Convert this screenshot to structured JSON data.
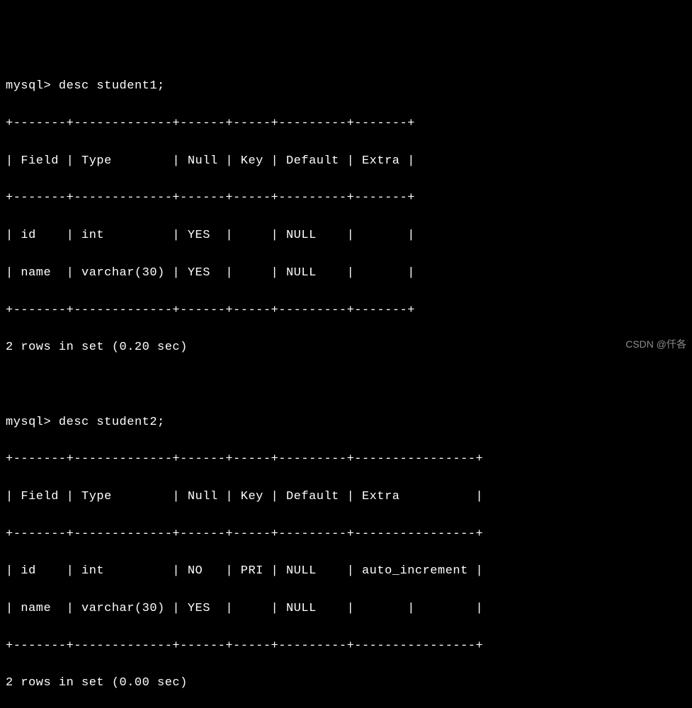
{
  "query1": {
    "prompt": "mysql> ",
    "command": "desc student1;",
    "border_top": "+-------+-------------+------+-----+---------+-------+",
    "header_row": "| Field | Type        | Null | Key | Default | Extra |",
    "border_mid": "+-------+-------------+------+-----+---------+-------+",
    "data_row1": "| id    | int         | YES  |     | NULL    |       |",
    "data_row2": "| name  | varchar(30) | YES  |     | NULL    |       |",
    "border_bot": "+-------+-------------+------+-----+---------+-------+",
    "summary": "2 rows in set (0.20 sec)",
    "chart_data": {
      "type": "table",
      "headers": [
        "Field",
        "Type",
        "Null",
        "Key",
        "Default",
        "Extra"
      ],
      "rows": [
        [
          "id",
          "int",
          "YES",
          "",
          "NULL",
          ""
        ],
        [
          "name",
          "varchar(30)",
          "YES",
          "",
          "NULL",
          ""
        ]
      ]
    }
  },
  "blank": " ",
  "query2": {
    "prompt": "mysql> ",
    "command": "desc student2;",
    "border_top": "+-------+-------------+------+-----+---------+----------------+",
    "header_row": "| Field | Type        | Null | Key | Default | Extra          |",
    "border_mid": "+-------+-------------+------+-----+---------+----------------+",
    "data_row1": "| id    | int         | NO   | PRI | NULL    | auto_increment |",
    "data_row2": "| name  | varchar(30) | YES  |     | NULL    |       |        |",
    "border_bot": "+-------+-------------+------+-----+---------+----------------+",
    "summary": "2 rows in set (0.00 sec)",
    "chart_data": {
      "type": "table",
      "headers": [
        "Field",
        "Type",
        "Null",
        "Key",
        "Default",
        "Extra"
      ],
      "rows": [
        [
          "id",
          "int",
          "NO",
          "PRI",
          "NULL",
          "auto_increment"
        ],
        [
          "name",
          "varchar(30)",
          "YES",
          "",
          "NULL",
          ""
        ]
      ]
    }
  },
  "watermark": "CSDN @仟各"
}
